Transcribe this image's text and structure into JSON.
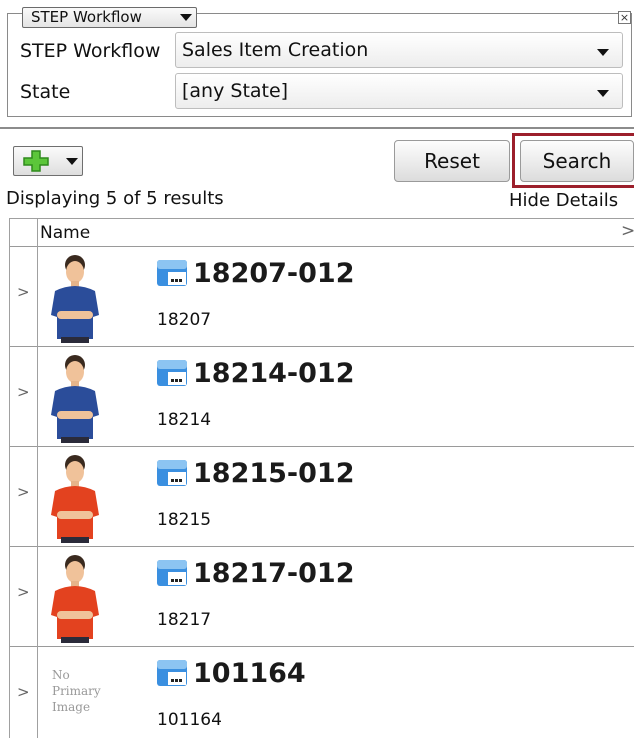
{
  "criteria": {
    "legend_select": "STEP Workflow",
    "close_icon": "×",
    "workflow_label": "STEP Workflow",
    "workflow_value": "Sales Item Creation",
    "state_label": "State",
    "state_value": "[any State]"
  },
  "toolbar": {
    "add_icon": "plus-icon",
    "reset_label": "Reset",
    "search_label": "Search",
    "results_text": "Displaying 5 of 5 results",
    "hide_details": "Hide Details"
  },
  "grid": {
    "column_name": "Name",
    "more_columns_glyph": ">",
    "expander_glyph": ">",
    "rows": [
      {
        "title": "18207-012",
        "id": "18207",
        "image": "man-blue-shirt",
        "shirt": "#2b4d9a"
      },
      {
        "title": "18214-012",
        "id": "18214",
        "image": "man-blue-shirt",
        "shirt": "#2b4d9a"
      },
      {
        "title": "18215-012",
        "id": "18215",
        "image": "man-red-shirt",
        "shirt": "#e3421f"
      },
      {
        "title": "18217-012",
        "id": "18217",
        "image": "man-red-shirt",
        "shirt": "#e3421f"
      },
      {
        "title": "101164",
        "id": "101164",
        "image": "no-primary-image",
        "no_image_lines": [
          "No",
          "Primary",
          "Image"
        ]
      }
    ]
  },
  "colors": {
    "focus_border": "#9c1f2b",
    "product_icon": "#3a8fe0"
  }
}
